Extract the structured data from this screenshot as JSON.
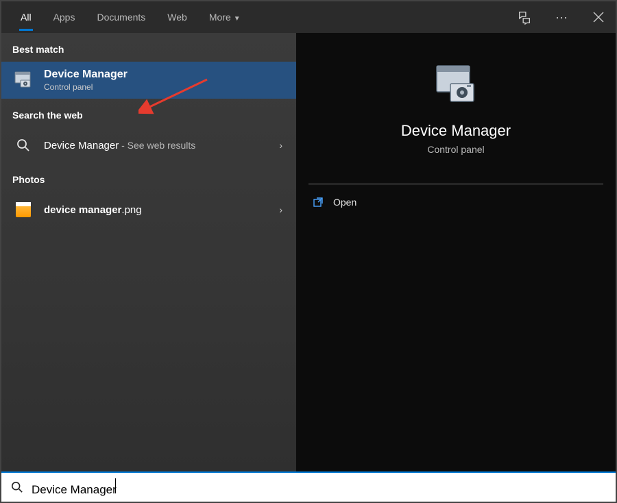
{
  "topbar": {
    "tabs": {
      "all": "All",
      "apps": "Apps",
      "documents": "Documents",
      "web": "Web",
      "more": "More"
    }
  },
  "left": {
    "best_match_header": "Best match",
    "result": {
      "title": "Device Manager",
      "subtitle": "Control panel"
    },
    "web_header": "Search the web",
    "web_result": {
      "prefix": "Device Manager",
      "suffix": " - See web results"
    },
    "photos_header": "Photos",
    "photo_item": {
      "prefix": "device manager",
      "suffix": ".png"
    }
  },
  "right": {
    "title": "Device Manager",
    "subtitle": "Control panel",
    "open_label": "Open"
  },
  "search": {
    "value": "Device Manager"
  }
}
